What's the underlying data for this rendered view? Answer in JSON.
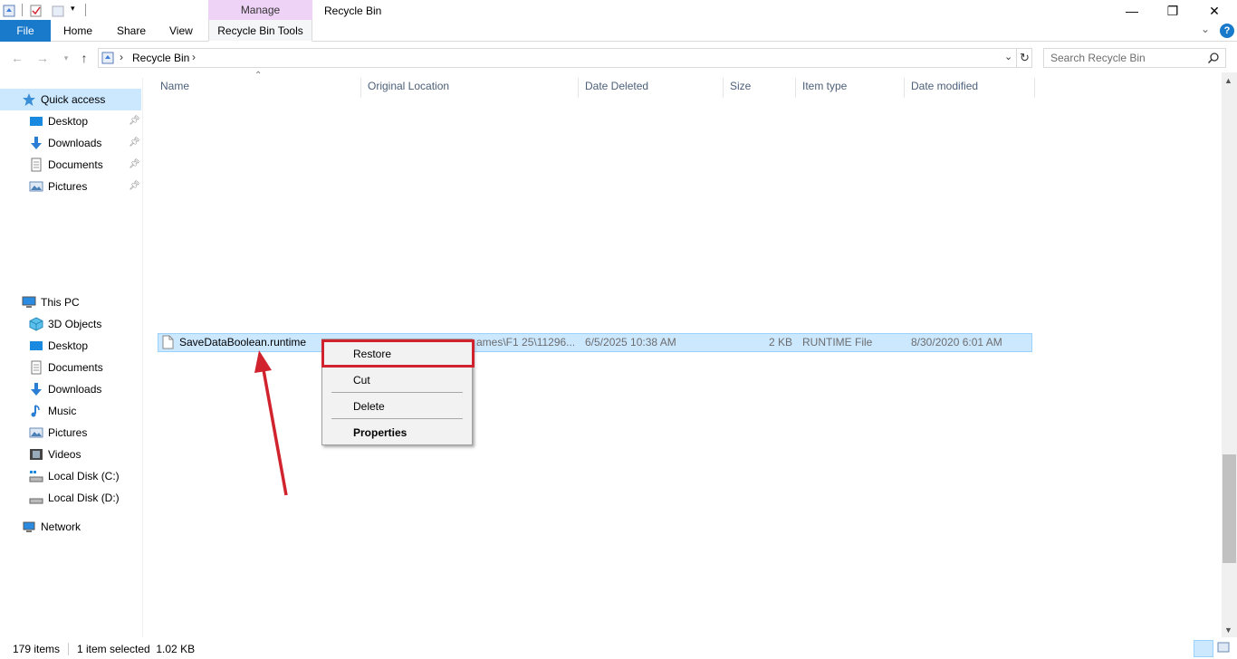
{
  "window": {
    "title": "Recycle Bin",
    "contextual_group": "Manage",
    "minimize": "—",
    "maximize": "❐",
    "close": "✕"
  },
  "ribbon": {
    "file": "File",
    "home": "Home",
    "share": "Share",
    "view": "View",
    "tools": "Recycle Bin Tools",
    "expand": "⌄",
    "help": "?"
  },
  "address": {
    "path": "Recycle Bin",
    "separator": "›",
    "search_placeholder": "Search Recycle Bin"
  },
  "sidebar": {
    "quick_access": "Quick access",
    "quick_items": [
      "Desktop",
      "Downloads",
      "Documents",
      "Pictures"
    ],
    "this_pc": "This PC",
    "pc_items": [
      "3D Objects",
      "Desktop",
      "Documents",
      "Downloads",
      "Music",
      "Pictures",
      "Videos",
      "Local Disk (C:)",
      "Local Disk (D:)"
    ],
    "network": "Network"
  },
  "columns": [
    "Name",
    "Original Location",
    "Date Deleted",
    "Size",
    "Item type",
    "Date modified"
  ],
  "selected_file": {
    "name": "SaveDataBoolean.runtime",
    "location": "ames\\F1 25\\11296...",
    "date_deleted": "6/5/2025 10:38 AM",
    "size": "2 KB",
    "type": "RUNTIME File",
    "date_modified": "8/30/2020 6:01 AM"
  },
  "context_menu": {
    "restore": "Restore",
    "cut": "Cut",
    "delete": "Delete",
    "properties": "Properties"
  },
  "status": {
    "count": "179 items",
    "selected": "1 item selected  1.02 KB"
  },
  "colors": {
    "accent": "#1979ca",
    "manage_tab": "#efd3f7",
    "selection": "#cce8ff",
    "highlight": "#d1232d"
  }
}
